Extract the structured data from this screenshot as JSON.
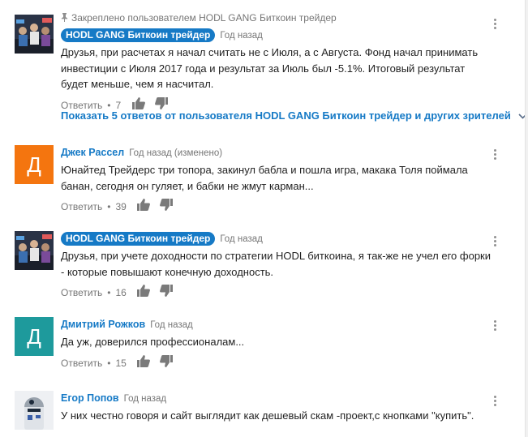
{
  "comments": [
    {
      "pinned_text": "Закреплено пользователем HODL GANG Биткоин трейдер",
      "author": "HODL GANG Биткоин трейдер",
      "time": "Год назад",
      "text": "Друзья, при расчетах я начал считать не с Июля, а с Августа. Фонд начал принимать инвестиции с Июля 2017 года и результат за Июль был -5.1%. Итоговый результат будет меньше, чем я насчитал.",
      "reply_label": "Ответить",
      "likes": "7",
      "show_replies": "Показать 5 ответов от пользователя HODL GANG Биткоин трейдер и других зрителей"
    },
    {
      "avatar_letter": "Д",
      "avatar_color": "#f4750f",
      "author": "Джек Рассел",
      "time": "Год назад (изменено)",
      "text": "Юнайтед Трейдерс три топора, закинул бабла и пошла игра, макака Толя поймала банан, сегодня он гуляет, и бабки не жмут карман...",
      "reply_label": "Ответить",
      "likes": "39"
    },
    {
      "author": "HODL GANG Биткоин трейдер",
      "time": "Год назад",
      "text": "Друзья, при учете доходности по стратегии HODL биткоина, я так-же не учел его форки - которые повышают конечную доходность.",
      "reply_label": "Ответить",
      "likes": "16"
    },
    {
      "avatar_letter": "Д",
      "avatar_color": "#1e9a9c",
      "author": "Дмитрий Рожков",
      "time": "Год назад",
      "text": "Да уж, доверился профессионалам...",
      "reply_label": "Ответить",
      "likes": "15"
    },
    {
      "author": "Егор Попов",
      "time": "Год назад",
      "text": "У них честно говоря и сайт выглядит как дешевый скам -проект,с кнопками \"купить\".",
      "reply_label": "Ответить",
      "likes": ""
    }
  ],
  "icons": {
    "pin": "pin-icon",
    "like": "thumb-up-icon",
    "dislike": "thumb-down-icon",
    "menu": "more-vert-icon",
    "expand": "chevron-down-icon"
  }
}
